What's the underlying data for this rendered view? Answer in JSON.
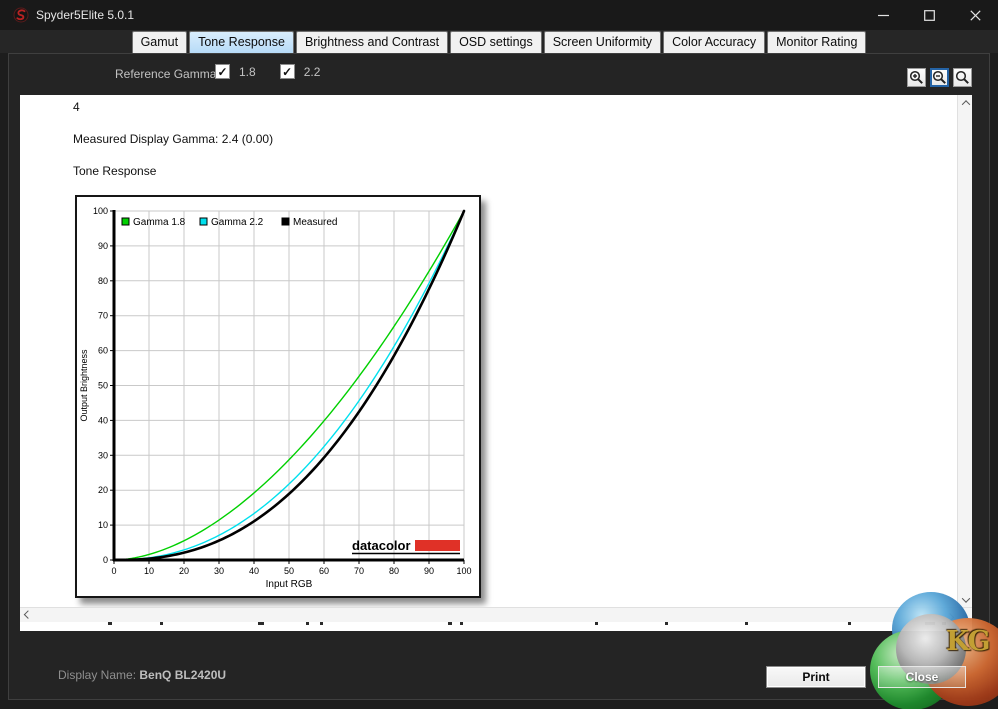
{
  "window": {
    "title": "Spyder5Elite 5.0.1"
  },
  "tabs": [
    {
      "label": "Gamut",
      "selected": false
    },
    {
      "label": "Tone Response",
      "selected": true
    },
    {
      "label": "Brightness and Contrast",
      "selected": false
    },
    {
      "label": "OSD settings",
      "selected": false
    },
    {
      "label": "Screen Uniformity",
      "selected": false
    },
    {
      "label": "Color Accuracy",
      "selected": false
    },
    {
      "label": "Monitor Rating",
      "selected": false
    }
  ],
  "toolbar": {
    "reference_gamma_label": "Reference Gamma:",
    "check_glyph": "✓",
    "checkboxes": [
      {
        "label": "1.8",
        "checked": true
      },
      {
        "label": "2.2",
        "checked": true
      }
    ],
    "zoom_buttons": [
      {
        "name": "zoom-in",
        "selected": false
      },
      {
        "name": "zoom-out",
        "selected": true
      },
      {
        "name": "zoom-reset",
        "selected": false
      }
    ]
  },
  "content": {
    "page_number": "4",
    "measured_gamma_text": "Measured Display Gamma: 2.4 (0.00)",
    "section_title": "Tone Response"
  },
  "chart_data": {
    "type": "line",
    "title": "Tone Response",
    "xlabel": "Input RGB",
    "ylabel": "Output Brightness",
    "xlim": [
      0,
      100
    ],
    "ylim": [
      0,
      100
    ],
    "x_ticks": [
      0,
      10,
      20,
      30,
      40,
      50,
      60,
      70,
      80,
      90,
      100
    ],
    "y_ticks": [
      0,
      10,
      20,
      30,
      40,
      50,
      60,
      70,
      80,
      90,
      100
    ],
    "grid": true,
    "legend_position": "top-left-inside",
    "curve_model": "y = 100*(x/100)^gamma",
    "series": [
      {
        "name": "Gamma 1.8",
        "color": "#00d000",
        "gamma": 1.8,
        "line_width": 1.4,
        "values": [
          0,
          1.6,
          5.5,
          11.5,
          19.2,
          28.7,
          39.9,
          52.6,
          66.9,
          82.7,
          100
        ]
      },
      {
        "name": "Gamma 2.2",
        "color": "#00e0ee",
        "gamma": 2.2,
        "line_width": 1.4,
        "values": [
          0,
          0.6,
          2.9,
          7.1,
          13.3,
          21.8,
          32.5,
          45.6,
          61.2,
          79.3,
          100
        ]
      },
      {
        "name": "Measured",
        "color": "#000000",
        "gamma": 2.4,
        "line_width": 2.6,
        "values": [
          0,
          0.4,
          2.1,
          5.6,
          11.1,
          19.0,
          29.4,
          42.5,
          58.5,
          77.6,
          100
        ]
      }
    ],
    "brand": {
      "text": "datacolor",
      "bar_color": "#e03127"
    }
  },
  "footer": {
    "display_name_label": "Display Name:",
    "display_name_value": "BenQ BL2420U",
    "print_label": "Print",
    "close_label": "Close"
  },
  "watermark": {
    "text": "KG"
  }
}
